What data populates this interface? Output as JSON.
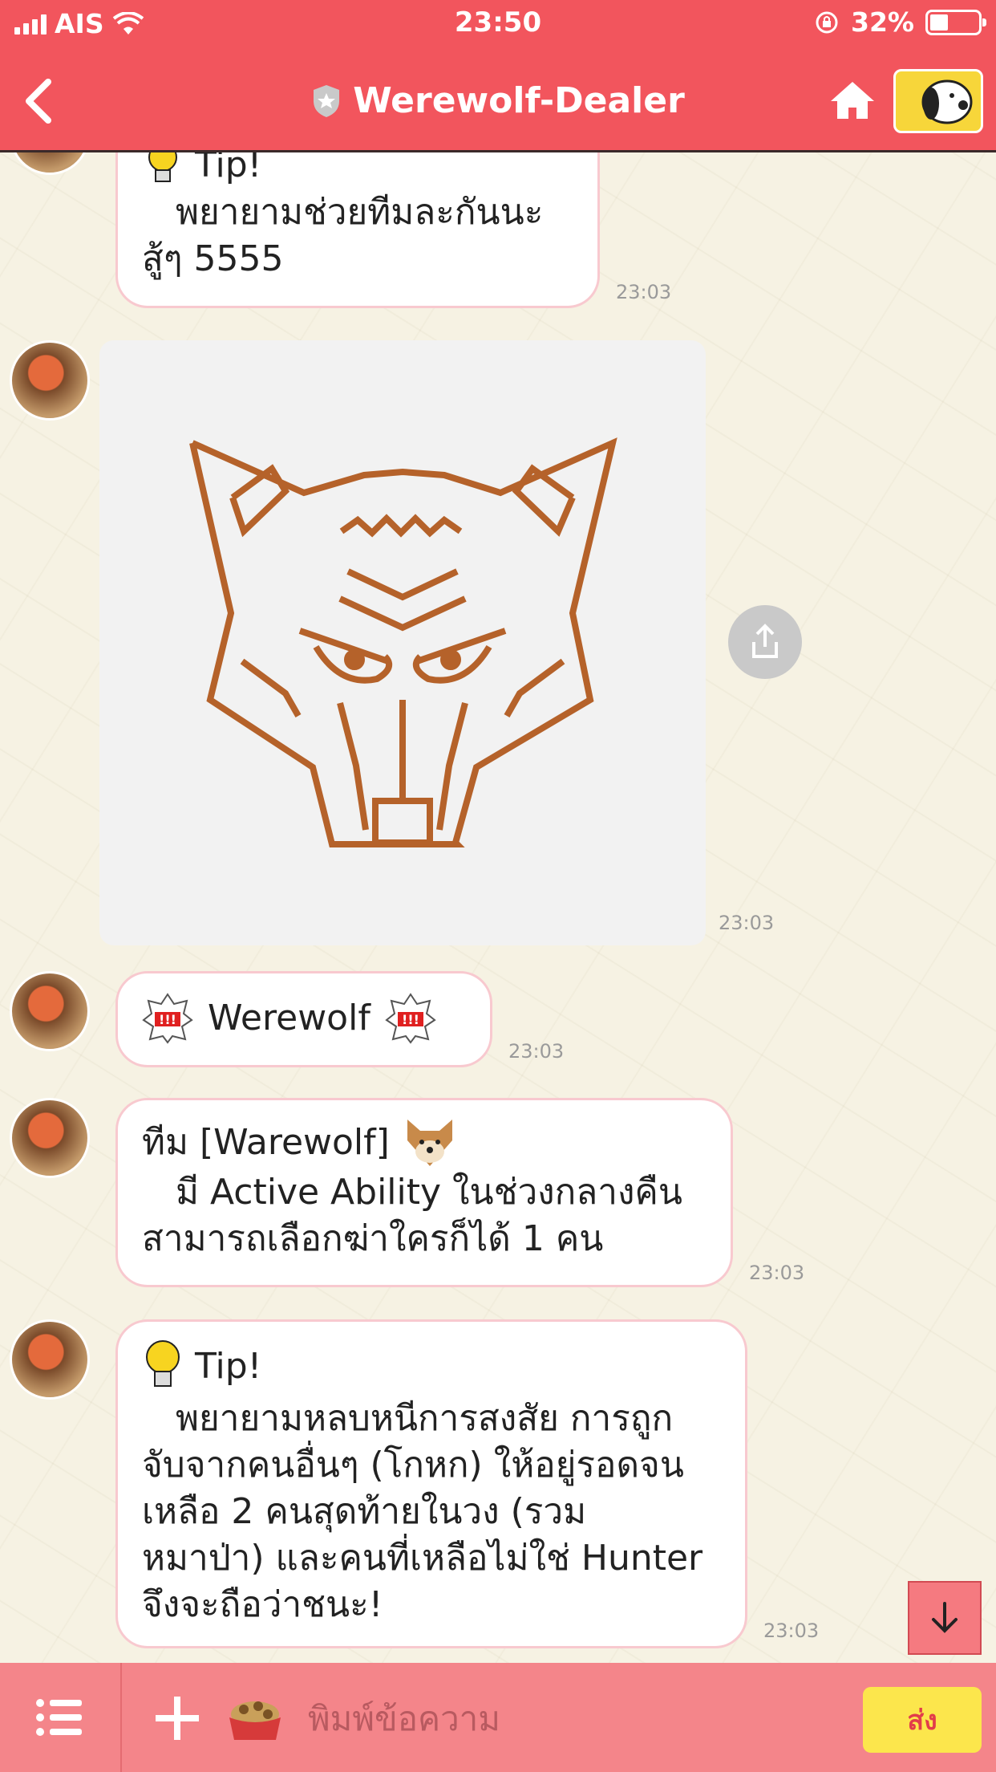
{
  "status_bar": {
    "carrier": "AIS",
    "time": "23:50",
    "battery": "32%"
  },
  "header": {
    "title": "Werewolf-Dealer"
  },
  "messages": [
    {
      "type": "tip",
      "title": "Tip!",
      "lines": [
        "   พยายามช่วยทีมละกันนะ",
        "สู้ๆ 5555"
      ],
      "time": "23:03"
    },
    {
      "type": "image",
      "description": "werewolf-logo",
      "time": "23:03"
    },
    {
      "type": "role",
      "text": "Werewolf",
      "time": "23:03"
    },
    {
      "type": "team",
      "title": "ทีม [Warewolf]",
      "lines": [
        "   มี Active Ability ในช่วงกลางคืน",
        "สามารถเลือกฆ่าใครก็ได้ 1 คน"
      ],
      "time": "23:03"
    },
    {
      "type": "tip",
      "title": "Tip!",
      "lines": [
        "   พยายามหลบหนีการสงสัย การถูก",
        "จับจากคนอื่นๆ (โกหก) ให้อยู่รอดจน",
        "เหลือ 2 คนสุดท้ายในวง (รวม",
        "หมาป่า) และคนที่เหลือไม่ใช่ Hunter",
        "จึงจะถือว่าชนะ!"
      ],
      "time": "23:03"
    }
  ],
  "input": {
    "placeholder": "พิมพ์ข้อความ"
  },
  "footer": {
    "send_label": "ส่ง"
  },
  "colors": {
    "header": "#f2555d",
    "footer": "#f4858a",
    "send": "#fce64c",
    "logo": "#b5622a"
  }
}
